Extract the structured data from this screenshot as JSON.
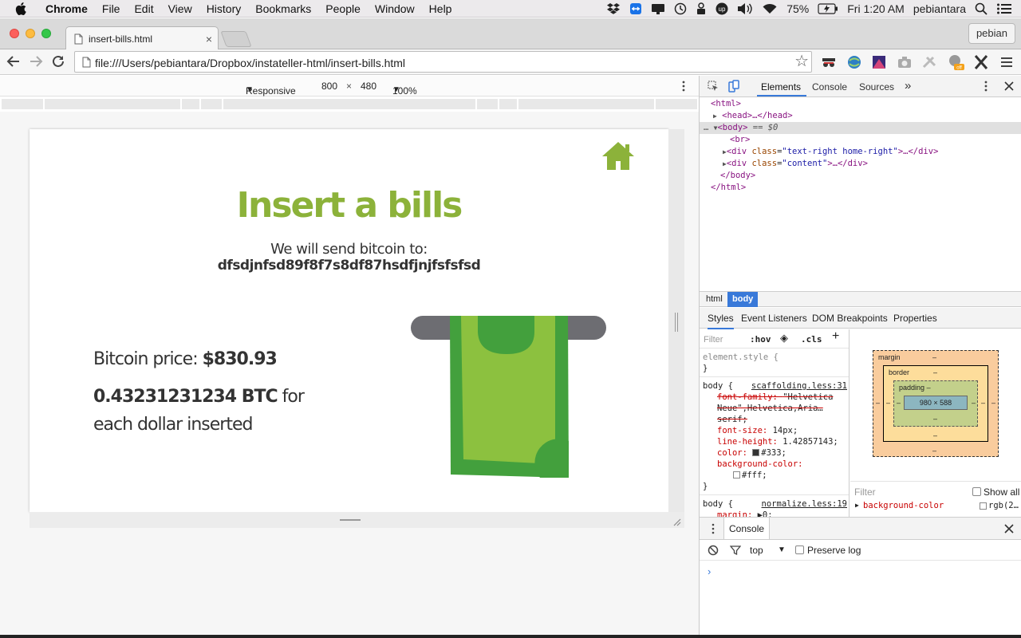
{
  "menubar": {
    "app_name": "Chrome",
    "items": [
      "File",
      "Edit",
      "View",
      "History",
      "Bookmarks",
      "People",
      "Window",
      "Help"
    ],
    "battery": "75%",
    "clock": "Fri 1:20 AM",
    "user": "pebiantara"
  },
  "browser": {
    "tab_title": "insert-bills.html",
    "tab_close": "×",
    "profile": "pebian",
    "url": "file:///Users/pebiantara/Dropbox/instateller-html/insert-bills.html"
  },
  "device_toolbar": {
    "mode": "Responsive",
    "width": "800",
    "times": "×",
    "height": "480",
    "zoom": "100%"
  },
  "page": {
    "heading": "Insert a bills",
    "send_label": "We will send bitcoin to:",
    "address": "dfsdjnfsd89f8f7s8df87hsdfjnjfsfsfsd",
    "price_label": "Bitcoin price:",
    "price_value": "$830.93",
    "rate_value": "0.43231231234 BTC",
    "rate_suffix": "for each dollar inserted",
    "accent_color": "#8cb23a"
  },
  "devtools": {
    "tabs": [
      "Elements",
      "Console",
      "Sources"
    ],
    "more": "»",
    "dom": {
      "html_open": "<html>",
      "head": "<head>…</head>",
      "body_open": "<body>",
      "body_marker": "== $0",
      "br": "<br>",
      "div1_class": "text-right home-right",
      "div2_class": "content",
      "body_close": "</body>",
      "html_close": "</html>"
    },
    "breadcrumbs": [
      "html",
      "body"
    ],
    "sub_tabs": [
      "Styles",
      "Event Listeners",
      "DOM Breakpoints",
      "Properties"
    ],
    "styles": {
      "filter_placeholder": "Filter",
      "hov": ":hov",
      "cls": ".cls",
      "add": "+",
      "element_style": "element.style {",
      "close_brace": "}",
      "rule1_selector": "body {",
      "rule1_source": "scaffolding.less:31",
      "rule1_props": [
        {
          "name": "font-family",
          "value": "\"Helvetica Neue\",Helvetica,Aria…serif;",
          "struck": true
        },
        {
          "name": "font-size",
          "value": "14px;"
        },
        {
          "name": "line-height",
          "value": "1.42857143;"
        },
        {
          "name": "color",
          "value": "#333;"
        },
        {
          "name": "background-color",
          "value": "#fff;"
        }
      ],
      "rule2_selector": "body {",
      "rule2_source": "normalize.less:19",
      "rule2_prop": {
        "name": "margin",
        "value": "0;"
      }
    },
    "box_model": {
      "margin": "margin",
      "border": "border",
      "padding": "padding",
      "content": "980 × 588",
      "dash": "–"
    },
    "computed": {
      "filter_placeholder": "Filter",
      "show_all": "Show all",
      "prop_name": "background-color",
      "prop_value": "rgb(2…"
    },
    "drawer": {
      "tab": "Console",
      "context": "top",
      "preserve_log": "Preserve log",
      "prompt": "›"
    }
  }
}
